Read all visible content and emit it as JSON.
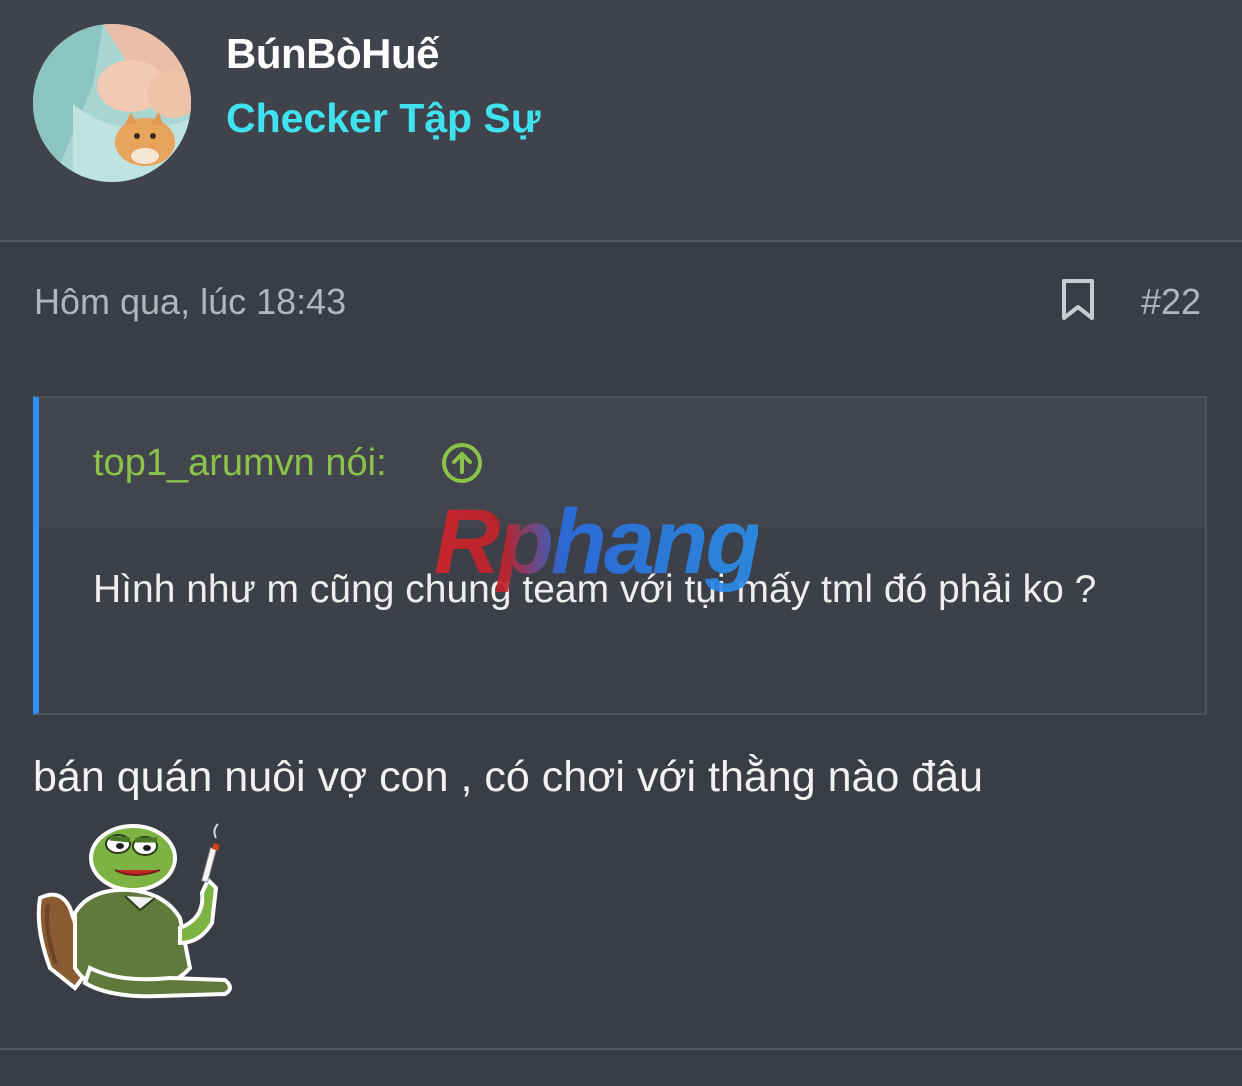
{
  "author": {
    "username": "BúnBòHuế",
    "title": "Checker Tập Sự"
  },
  "post": {
    "timestamp": "Hôm qua, lúc 18:43",
    "number": "#22",
    "bookmark_icon": "bookmark-icon"
  },
  "quote": {
    "author_label": "top1_arumvn nói:",
    "jump_icon": "arrow-up-circle-icon",
    "text": "Hình như m cũng chung team với tụi mấy tml đó phải ko ?"
  },
  "watermark": "Rphang",
  "reply": {
    "text": "bán quán nuôi vợ con , có chơi với thằng nào đâu",
    "sticker": "pepe-frog-smoking-sticker"
  },
  "colors": {
    "background": "#3a3d45",
    "username": "#ffffff",
    "user_title": "#3fe3ef",
    "quote_author": "#8bc34a",
    "quote_border": "#2f8ff2",
    "meta": "#b3b5ba"
  }
}
